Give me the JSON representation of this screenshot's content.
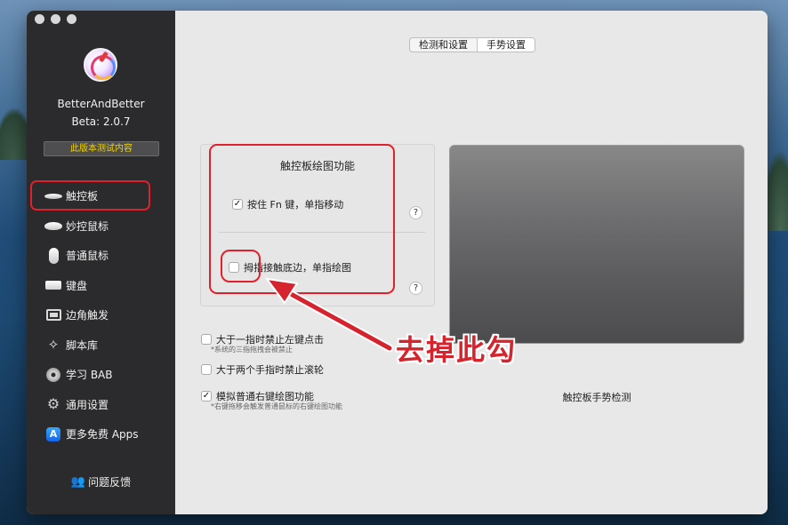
{
  "sidebar": {
    "app_name": "BetterAndBetter",
    "app_version": "Beta: 2.0.7",
    "beta_badge": "此版本测试内容",
    "items": [
      {
        "label": "触控板",
        "icon": "trackpad-icon"
      },
      {
        "label": "妙控鼠标",
        "icon": "magic-mouse-icon"
      },
      {
        "label": "普通鼠标",
        "icon": "mouse-icon"
      },
      {
        "label": "键盘",
        "icon": "keyboard-icon"
      },
      {
        "label": "边角触发",
        "icon": "hot-corner-icon"
      },
      {
        "label": "脚本库",
        "icon": "script-icon"
      },
      {
        "label": "学习 BAB",
        "icon": "disc-icon"
      },
      {
        "label": "通用设置",
        "icon": "gear-icon"
      },
      {
        "label": "更多免费 Apps",
        "icon": "app-store-icon"
      }
    ],
    "feedback": "问题反馈"
  },
  "tabs": [
    {
      "label": "检测和设置",
      "active": false
    },
    {
      "label": "手势设置",
      "active": true
    }
  ],
  "draw_group": {
    "title": "触控板绘图功能",
    "option1": {
      "label": "按住 Fn 键，单指移动",
      "checked": true
    },
    "option2": {
      "label": "拇指接触底边，单指绘图",
      "checked": false
    },
    "help": "?"
  },
  "options": {
    "opt1": {
      "label": "大于一指时禁止左键点击",
      "note": "*系统的三指拖拽会被禁止",
      "checked": false
    },
    "opt2": {
      "label": "大于两个手指时禁止滚轮",
      "checked": false
    },
    "opt3": {
      "label": "模拟普通右键绘图功能",
      "note": "*右键拖移会触发普通鼠标的右键绘图功能",
      "checked": true
    }
  },
  "trackpad_label": "触控板手势检测",
  "annotation": "去掉此勾",
  "colors": {
    "annotation_red": "#d6242e",
    "sidebar_bg": "#2b2b2d",
    "badge_text": "#f2d200"
  }
}
